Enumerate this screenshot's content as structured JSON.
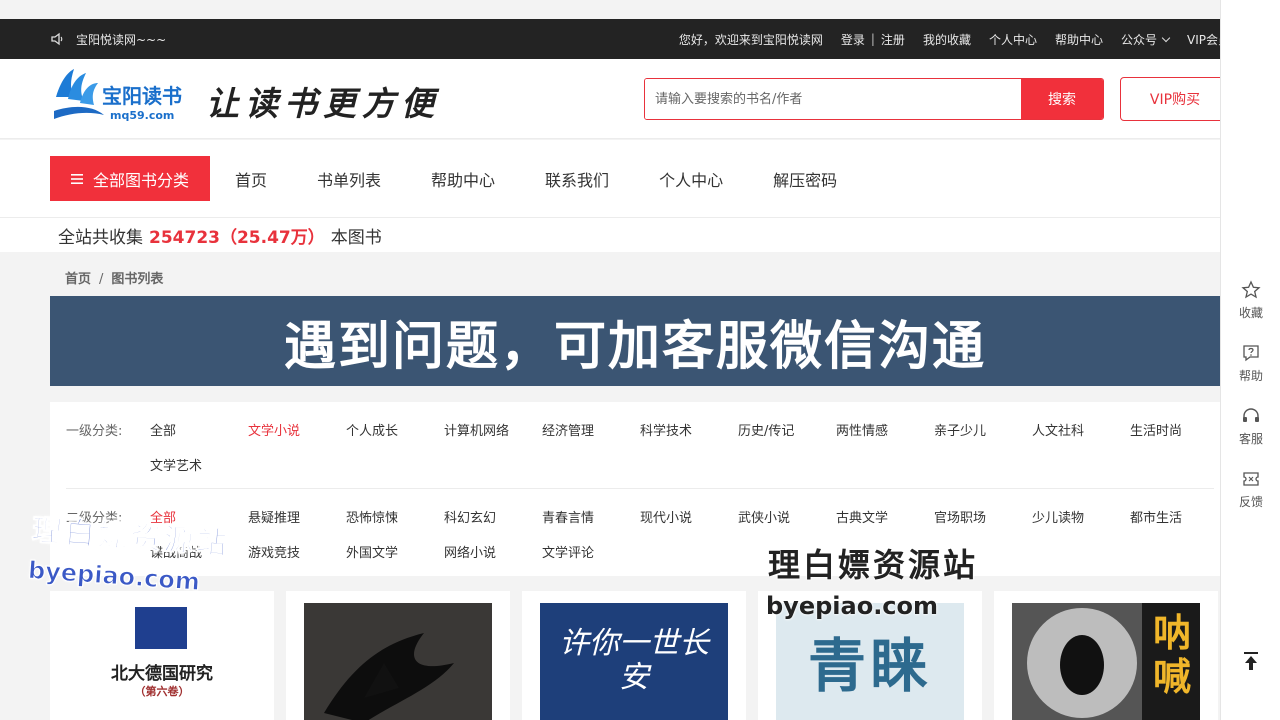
{
  "topbar": {
    "site_name": "宝阳悦读网~~~",
    "welcome": "您好，欢迎来到宝阳悦读网",
    "login": "登录",
    "separator": "|",
    "register": "注册",
    "favorites": "我的收藏",
    "profile": "个人中心",
    "help": "帮助中心",
    "wechat": "公众号",
    "vip": "VIP会员"
  },
  "header": {
    "logo_text": "宝阳读书",
    "logo_domain": "mq59.com",
    "slogan": "让读书更方便",
    "search_placeholder": "请输入要搜索的书名/作者",
    "search_button": "搜索",
    "vip_button": "VIP购买"
  },
  "nav": {
    "all_categories": "全部图书分类",
    "items": [
      "首页",
      "书单列表",
      "帮助中心",
      "联系我们",
      "个人中心",
      "解压密码"
    ]
  },
  "stats": {
    "prefix": "全站共收集",
    "count": "254723（25.47万）",
    "suffix": "本图书"
  },
  "breadcrumb": {
    "home": "首页",
    "separator": "/",
    "current": "图书列表"
  },
  "banner": {
    "text": "遇到问题，可加客服微信沟通"
  },
  "filters": {
    "level1_label": "一级分类:",
    "level1": [
      "全部",
      "文学小说",
      "个人成长",
      "计算机网络",
      "经济管理",
      "科学技术",
      "历史/传记",
      "两性情感",
      "亲子少儿",
      "人文社科",
      "生活时尚",
      "文学艺术"
    ],
    "level1_active": "文学小说",
    "level2_label": "二级分类:",
    "level2": [
      "全部",
      "悬疑推理",
      "恐怖惊悚",
      "科幻玄幻",
      "青春言情",
      "现代小说",
      "武侠小说",
      "古典文学",
      "官场职场",
      "少儿读物",
      "都市生活",
      "谍战商战",
      "游戏竞技",
      "外国文学",
      "网络小说",
      "文学评论"
    ],
    "level2_active": "全部"
  },
  "books": [
    {
      "title": "北大德国研究",
      "subtitle": "（第六卷）",
      "cover_bg": "#ffffff"
    },
    {
      "title": "",
      "cover_bg": "#1a1a1a"
    },
    {
      "title": "许你一世长安",
      "cover_bg": "#1e3f7a"
    },
    {
      "title": "青睐",
      "cover_bg": "#dde9ef"
    },
    {
      "title": "呐喊",
      "cover_bg": "#2a2a2a"
    }
  ],
  "sidebar": {
    "items": [
      "收藏",
      "帮助",
      "客服",
      "反馈"
    ]
  },
  "watermarks": {
    "cn": "理白嫖资源站",
    "en": "byepiao.com"
  },
  "colors": {
    "accent": "#f1303b",
    "topbar_bg": "#232323",
    "banner_bg": "#3b5573"
  }
}
